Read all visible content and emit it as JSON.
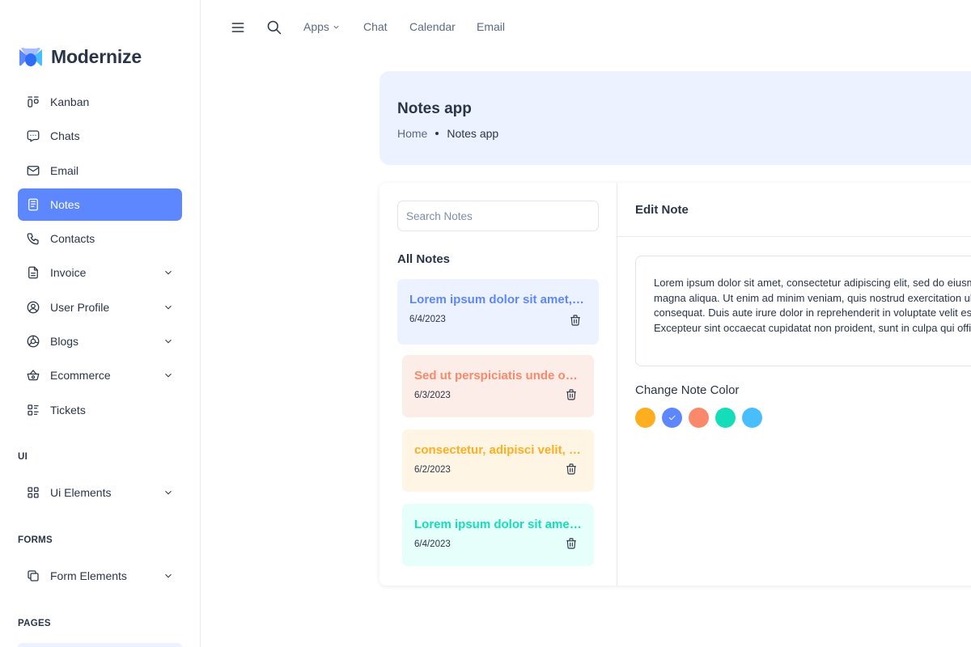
{
  "brand": {
    "name": "Modernize"
  },
  "sidebar": {
    "items": [
      {
        "label": "Kanban",
        "icon": "kanban-icon"
      },
      {
        "label": "Chats",
        "icon": "chat-icon"
      },
      {
        "label": "Email",
        "icon": "mail-icon"
      },
      {
        "label": "Notes",
        "icon": "notes-icon",
        "active": true
      },
      {
        "label": "Contacts",
        "icon": "phone-icon"
      },
      {
        "label": "Invoice",
        "icon": "invoice-icon",
        "expandable": true
      },
      {
        "label": "User Profile",
        "icon": "user-circle-icon",
        "expandable": true
      },
      {
        "label": "Blogs",
        "icon": "blog-icon",
        "expandable": true
      },
      {
        "label": "Ecommerce",
        "icon": "basket-icon",
        "expandable": true
      },
      {
        "label": "Tickets",
        "icon": "tickets-icon"
      }
    ],
    "sections": {
      "ui": {
        "heading": "UI",
        "item": {
          "label": "Ui Elements",
          "icon": "layout-grid-icon"
        }
      },
      "forms": {
        "heading": "FORMS",
        "item": {
          "label": "Form Elements",
          "icon": "copy-icon"
        }
      },
      "pages": {
        "heading": "PAGES"
      }
    }
  },
  "topbar": {
    "links": {
      "apps": "Apps",
      "chat": "Chat",
      "calendar": "Calendar",
      "email": "Email"
    }
  },
  "header": {
    "title": "Notes app",
    "breadcrumb": {
      "home": "Home",
      "current": "Notes app"
    }
  },
  "notes": {
    "search_placeholder": "Search Notes",
    "heading": "All Notes",
    "items": [
      {
        "title": "Lorem ipsum dolor sit amet, consectetur adipiscing elit.",
        "date": "6/4/2023",
        "color": "#5d87ff",
        "bg": "#ecf2ff",
        "selected": true
      },
      {
        "title": "Sed ut perspiciatis unde omnis iste natus",
        "date": "6/3/2023",
        "color": "#fa896b",
        "bg": "#fdede8"
      },
      {
        "title": "consectetur, adipisci velit, sed quia non",
        "date": "6/2/2023",
        "color": "#ffae1f",
        "bg": "#fef5e5"
      },
      {
        "title": "Lorem ipsum dolor sit amet, consectetur adipiscing elit.",
        "date": "6/4/2023",
        "color": "#13deb9",
        "bg": "#e6fffa"
      }
    ]
  },
  "editor": {
    "heading": "Edit Note",
    "body_lines": [
      "Lorem ipsum dolor sit amet, consectetur adipiscing elit, sed do eiusmod tempor incididunt ut labore et dolore",
      "magna aliqua. Ut enim ad minim veniam, quis nostrud exercitation ullamco laboris nisi ut aliquip ex ea commodo",
      "consequat. Duis aute irure dolor in reprehenderit in voluptate velit esse cillum dolore eu fugiat nulla pariatur.",
      "Excepteur sint occaecat cupidatat non proident, sunt in culpa qui officia deserunt mollit anim id est laborum."
    ],
    "color_heading": "Change Note Color",
    "colors": [
      {
        "name": "warning",
        "hex": "#ffae1f"
      },
      {
        "name": "primary",
        "hex": "#5d87ff",
        "selected": true
      },
      {
        "name": "error",
        "hex": "#fa896b"
      },
      {
        "name": "success",
        "hex": "#13deb9"
      },
      {
        "name": "info",
        "hex": "#49beff"
      }
    ]
  }
}
